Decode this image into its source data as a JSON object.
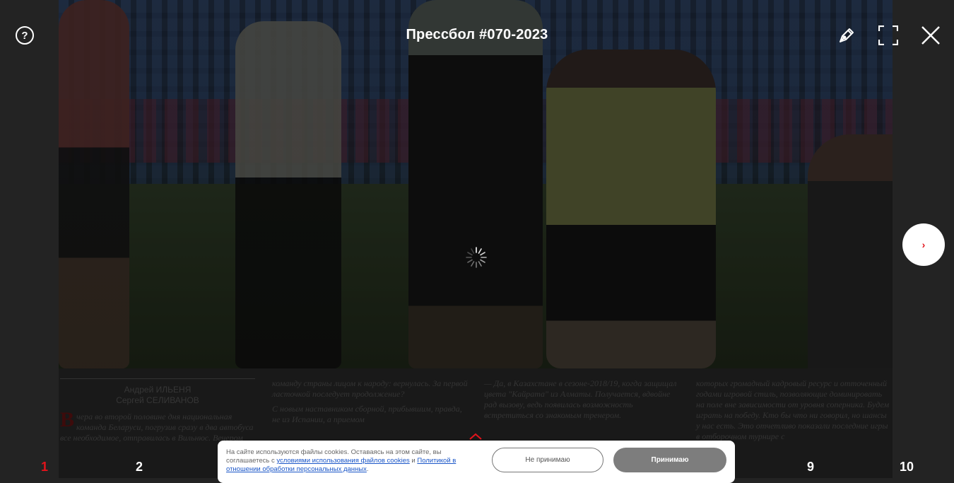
{
  "header": {
    "title": "Прессбол #070-2023",
    "help_icon": "question-circle-icon",
    "pen_icon": "pen-icon",
    "fullscreen_icon": "fullscreen-icon",
    "close_icon": "close-icon"
  },
  "viewer": {
    "next_icon": "chevron-right-icon",
    "next_symbol": "›",
    "loading_icon": "spinner-icon",
    "accent_color": "#e3131b"
  },
  "article": {
    "authors": [
      "Андрей ИЛЬЕНЯ",
      "Сергей СЕЛИВАНОВ"
    ],
    "dropcap": "В",
    "col1_text": "чера во второй половине дня национальная команда Беларуси, погрузив сразу в два автобуса все необходимое, отправилась в Вильнюс. Вечером",
    "col2_p1": "команду страны лицом к народу: вернулась. За первой ласточкой последует продолжение?",
    "col2_p2": "С новым наставником сборной, прибывшим, правда, не из Испании, а приемом",
    "col3_p1": "— Да, в Казахстане в сезоне-2018/19, когда защищал цвета \"Кайрата\" из Алматы. Получается, вдвойне рад вызову, ведь появилась возможность встретиться со знакомым тренером.",
    "col4_p1": "которых громадный кадровый ресурс и отточенный годами игровой стиль, позволяющие доминировать на поле вне зависимости от уровня соперника. Будем играть на победу. Кто бы что ни говорил, но шансы у нас есть. Это отчетливо показали последние игры в отборочном турнире с"
  },
  "pagination": {
    "pages": [
      {
        "label": "1",
        "active": true
      },
      {
        "label": "2",
        "active": false
      },
      {
        "label": "9",
        "active": false
      },
      {
        "label": "10",
        "active": false
      }
    ]
  },
  "cookie": {
    "text_before": "На сайте используются файлы cookies. Оставаясь на этом сайте, вы соглашаетесь с ",
    "link1": "условиями использования файлов cookies",
    "text_middle": " и ",
    "link2": "Политикой в отношении обработки персональных данных",
    "text_after": ".",
    "decline_label": "Не принимаю",
    "accept_label": "Принимаю",
    "caret_icon": "chevron-up-icon"
  }
}
